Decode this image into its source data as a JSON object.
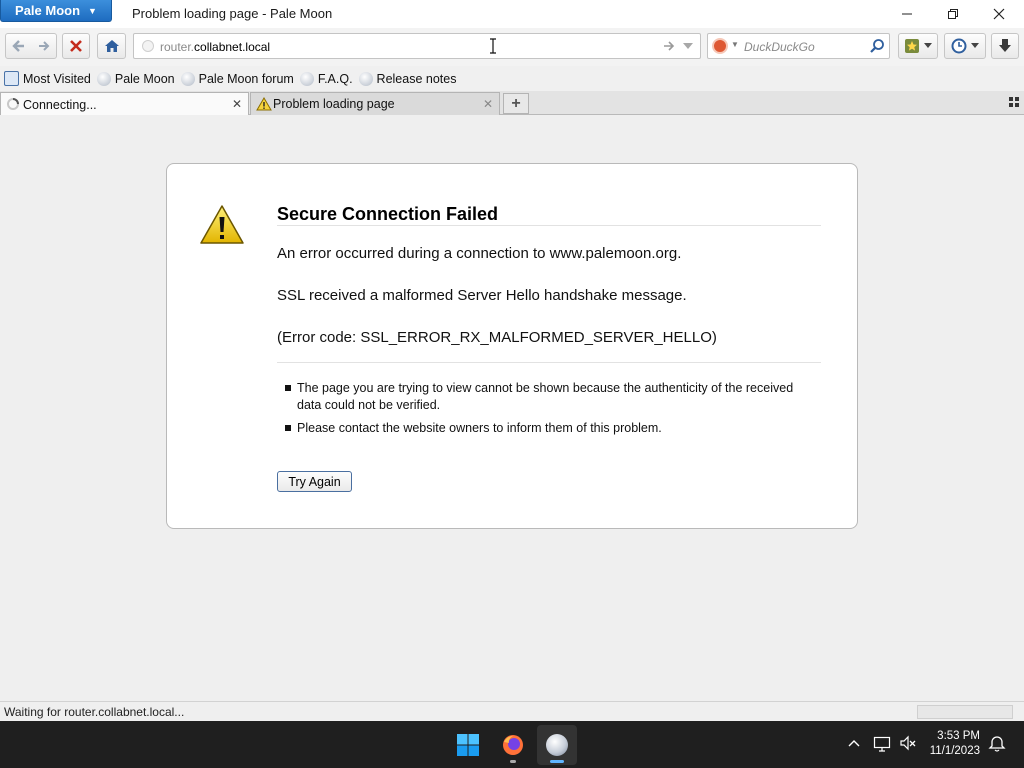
{
  "window": {
    "app_menu_label": "Pale Moon",
    "title": "Problem loading page - Pale Moon"
  },
  "navbar": {
    "url_prefix": "router.",
    "url_domain": "collabnet.local",
    "search_placeholder": "DuckDuckGo"
  },
  "bookmarks": [
    {
      "label": "Most Visited",
      "icon": "most-visited-icon"
    },
    {
      "label": "Pale Moon",
      "icon": "globe-icon"
    },
    {
      "label": "Pale Moon forum",
      "icon": "globe-icon"
    },
    {
      "label": "F.A.Q.",
      "icon": "globe-icon"
    },
    {
      "label": "Release notes",
      "icon": "globe-icon"
    }
  ],
  "tabs": [
    {
      "label": "Connecting...",
      "icon": "loading-icon",
      "active": true
    },
    {
      "label": "Problem loading page",
      "icon": "warning-icon",
      "active": false
    }
  ],
  "error": {
    "title": "Secure Connection Failed",
    "line1": "An error occurred during a connection to www.palemoon.org.",
    "line2": "SSL received a malformed Server Hello handshake message.",
    "line3": "(Error code: SSL_ERROR_RX_MALFORMED_SERVER_HELLO)",
    "bullets": [
      "The page you are trying to view cannot be shown because the authenticity of the received data could not be verified.",
      "Please contact the website owners to inform them of this problem."
    ],
    "button": "Try Again"
  },
  "status": {
    "text": "Waiting for router.collabnet.local..."
  },
  "taskbar": {
    "time": "3:53 PM",
    "date": "11/1/2023"
  },
  "colors": {
    "accent": "#2a7bd1",
    "taskbar": "#1f1f1f",
    "stop": "#c42b1c"
  }
}
